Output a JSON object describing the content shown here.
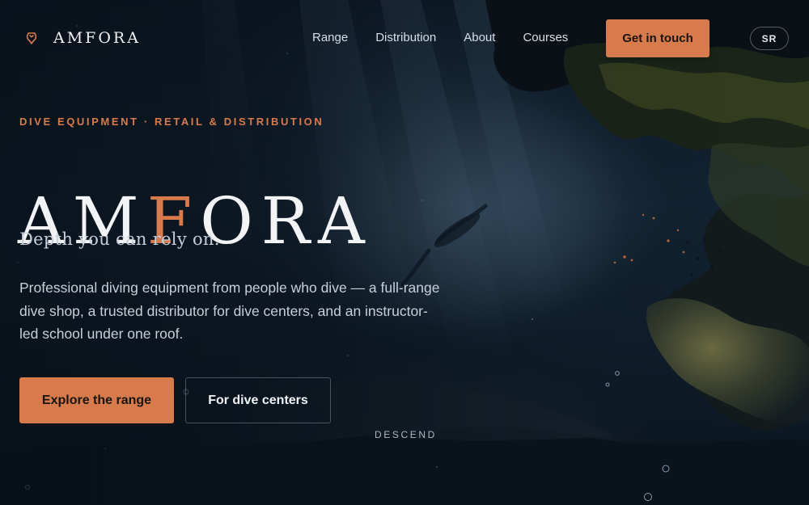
{
  "header": {
    "brand": "AMFORA",
    "logo_icon": "amphora-icon",
    "nav": [
      {
        "label": "Range"
      },
      {
        "label": "Distribution"
      },
      {
        "label": "About"
      },
      {
        "label": "Courses"
      }
    ],
    "cta_label": "Get in touch",
    "language": "SR"
  },
  "hero": {
    "eyebrow": "DIVE EQUIPMENT · RETAIL & DISTRIBUTION",
    "title_part1": "AM",
    "title_accent": "F",
    "title_part2": "ORA",
    "tagline": "Depth you can rely on.",
    "description": "Professional diving equipment from people who dive — a full-range dive shop, a trusted distributor for dive centers, and an instructor-led school under one roof.",
    "primary_button": "Explore the range",
    "secondary_button": "For dive centers",
    "scroll_hint": "DESCEND"
  },
  "colors": {
    "accent": "#d77a4c",
    "background": "#0b1622",
    "text": "#e7ecf1"
  }
}
